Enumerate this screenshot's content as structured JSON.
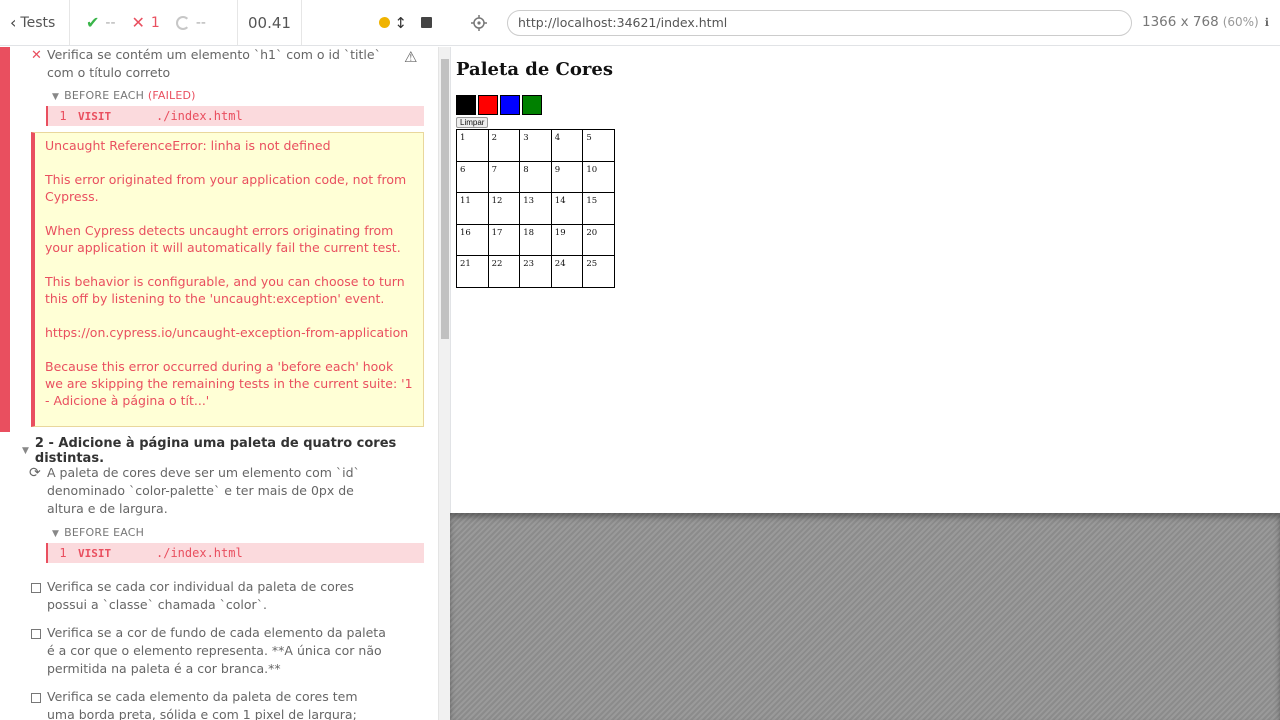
{
  "top_bar": {
    "tests_label": "Tests",
    "passed": "--",
    "failed": "1",
    "pending": "--",
    "duration": "00.41"
  },
  "suite1": {
    "test_title": "Verifica se contém um elemento `h1` com o id `title` com o título correto",
    "hook_label": "BEFORE EACH",
    "hook_failed": "(FAILED)",
    "command": {
      "num": "1",
      "name": "VISIT",
      "message": "./index.html"
    },
    "error": [
      "Uncaught ReferenceError: linha is not defined",
      "This error originated from your application code, not from Cypress.",
      "When Cypress detects uncaught errors originating from your application it will automatically fail the current test.",
      "This behavior is configurable, and you can choose to turn this off by listening to the 'uncaught:exception' event.",
      "https://on.cypress.io/uncaught-exception-from-application",
      "Because this error occurred during a 'before each' hook we are skipping the remaining tests in the current suite: '1 - Adicione à página o tít...'"
    ]
  },
  "suite2": {
    "title": "2 - Adicione à página uma paleta de quatro cores distintas.",
    "running_test": "A paleta de cores deve ser um elemento com `id` denominado `color-palette` e ter mais de 0px de altura e de largura.",
    "hook_label": "BEFORE EACH",
    "command": {
      "num": "1",
      "name": "VISIT",
      "message": "./index.html"
    },
    "pending_tests": [
      "Verifica se cada cor individual da paleta de cores possui a `classe` chamada `color`.",
      "Verifica se a cor de fundo de cada elemento da paleta é a cor que o elemento representa. **A única cor não permitida na paleta é a cor branca.**",
      "Verifica se cada elemento da paleta de cores tem uma borda preta, sólida e com 1 pixel de largura;"
    ]
  },
  "aut": {
    "url": "http://localhost:34621/index.html",
    "viewport": "1366 x 768",
    "scale": "(60%)",
    "app": {
      "title": "Paleta de Cores",
      "palette_colors": [
        "#000000",
        "#ff0000",
        "#0000ff",
        "#008000"
      ],
      "clear_button": "Limpar",
      "pixels": [
        "1",
        "2",
        "3",
        "4",
        "5",
        "6",
        "7",
        "8",
        "9",
        "10",
        "11",
        "12",
        "13",
        "14",
        "15",
        "16",
        "17",
        "18",
        "19",
        "20",
        "21",
        "22",
        "23",
        "24",
        "25"
      ]
    }
  }
}
